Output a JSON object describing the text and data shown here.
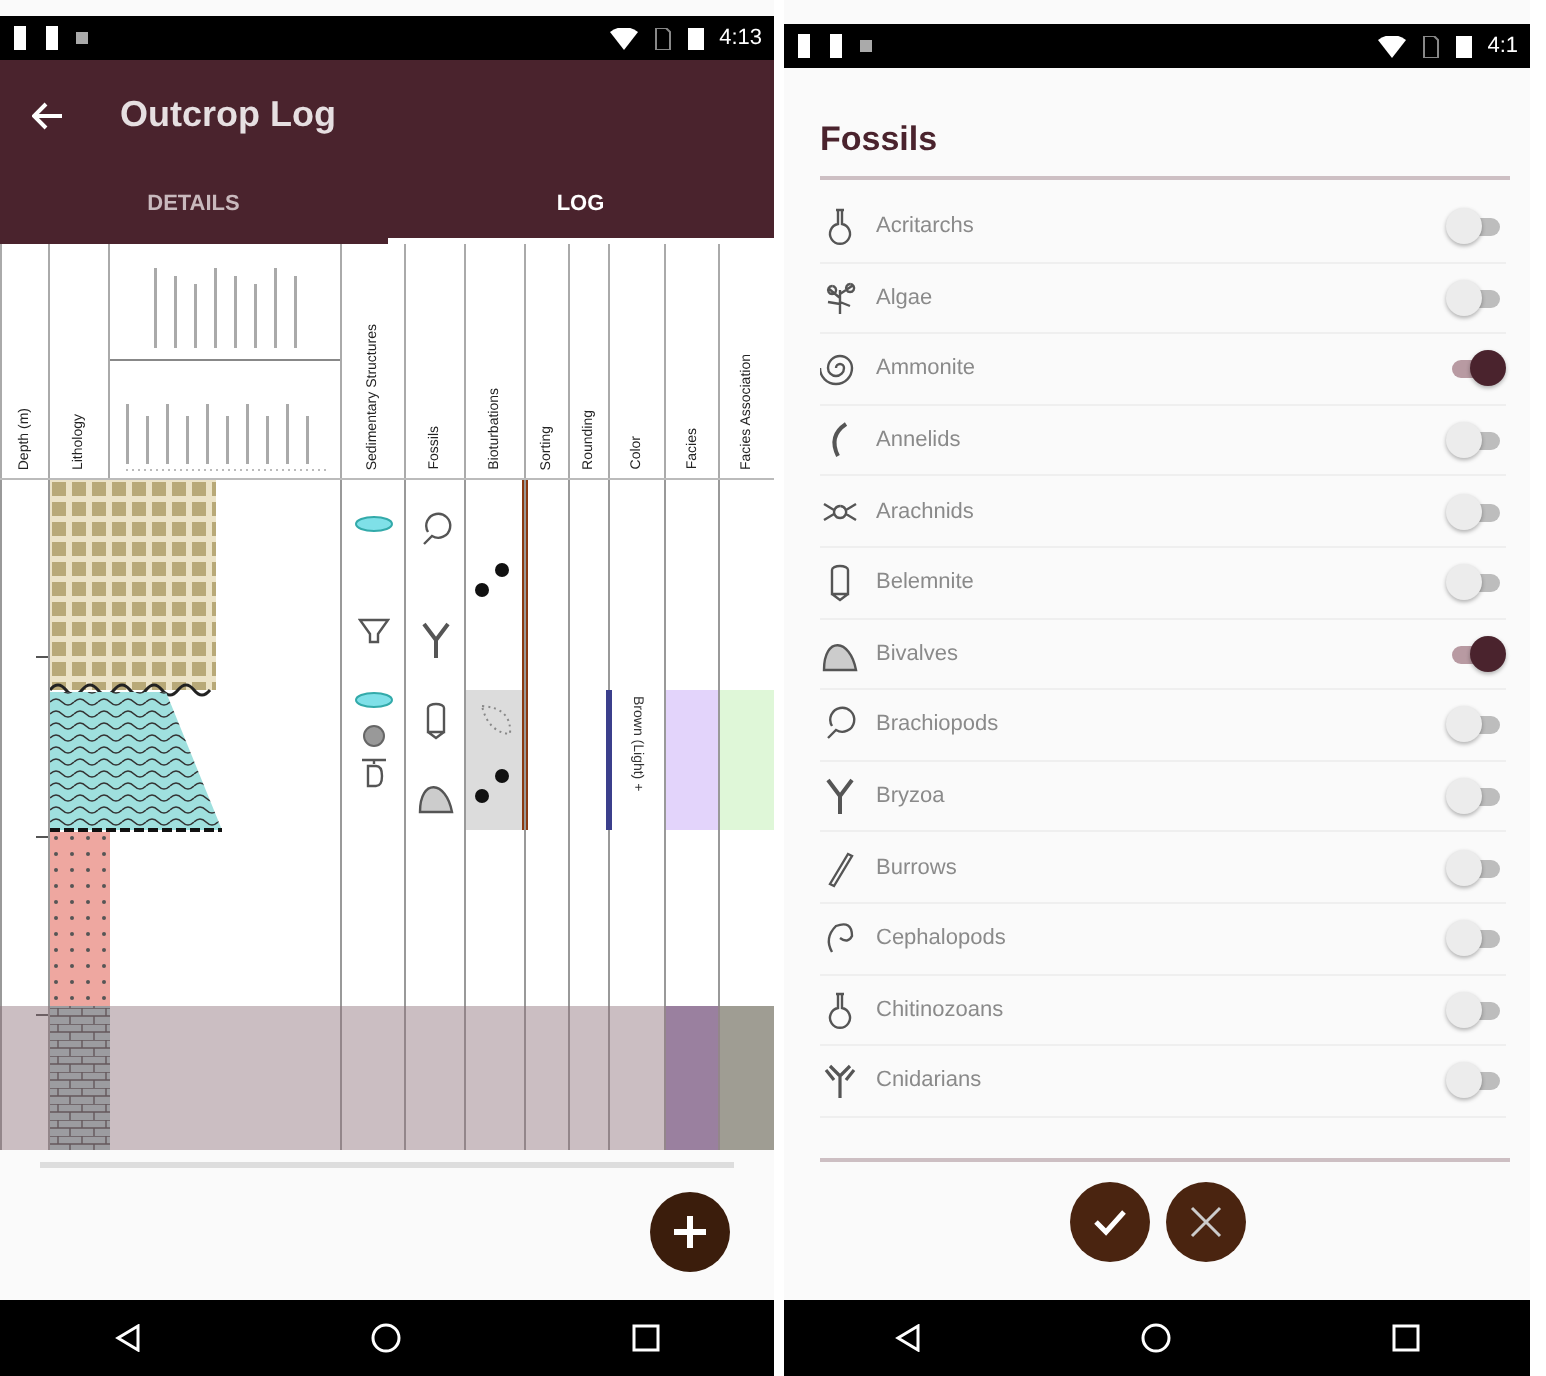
{
  "log_screen": {
    "status_bar": {
      "time": "4:13"
    },
    "app_bar": {
      "title": "Outcrop Log"
    },
    "tabs": [
      {
        "label": "DETAILS",
        "selected": false
      },
      {
        "label": "LOG",
        "selected": true
      }
    ],
    "log": {
      "columns": [
        {
          "kind": "depth",
          "heading": "Depth (m)"
        },
        {
          "kind": "lithology",
          "heading": "Lithology"
        },
        {
          "kind": "grain"
        },
        {
          "kind": "structures",
          "heading": "Sedimentary Structures"
        },
        {
          "kind": "fossils",
          "heading": "Fossils"
        },
        {
          "kind": "bioturbation",
          "heading": "Bioturbations"
        },
        {
          "kind": "plain",
          "heading": "Sorting"
        },
        {
          "kind": "plain",
          "heading": "Rounding"
        },
        {
          "kind": "color",
          "heading": "Color"
        },
        {
          "kind": "facies",
          "heading": "Facies"
        },
        {
          "kind": "association",
          "heading": "Facies Association"
        }
      ],
      "color_note": "Brown (Light) +"
    }
  },
  "fossil_screen": {
    "status_bar": {
      "time": "4:1"
    },
    "title": "Fossils",
    "items": [
      {
        "label": "Acritarchs",
        "on": false
      },
      {
        "label": "Algae",
        "on": false
      },
      {
        "label": "Ammonite",
        "on": true
      },
      {
        "label": "Annelids",
        "on": false
      },
      {
        "label": "Arachnids",
        "on": false
      },
      {
        "label": "Belemnite",
        "on": false
      },
      {
        "label": "Bivalves",
        "on": true
      },
      {
        "label": "Brachiopods",
        "on": false
      },
      {
        "label": "Bryzoa",
        "on": false
      },
      {
        "label": "Burrows",
        "on": false
      },
      {
        "label": "Cephalopods",
        "on": false
      },
      {
        "label": "Chitinozoans",
        "on": false
      },
      {
        "label": "Cnidarians",
        "on": false
      }
    ]
  }
}
